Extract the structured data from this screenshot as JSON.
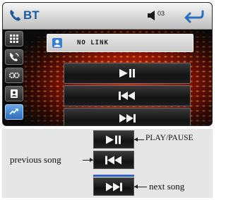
{
  "header": {
    "title": "BT",
    "volume_level": "03",
    "phone_icon": "phone-icon",
    "back_icon": "return-arrow-icon"
  },
  "sidebar": {
    "items": [
      {
        "name": "menu-grid",
        "icon": "grid-icon"
      },
      {
        "name": "dial",
        "icon": "phone-dial-icon"
      },
      {
        "name": "settings",
        "icon": "settings-icon"
      },
      {
        "name": "contacts",
        "icon": "contacts-icon"
      },
      {
        "name": "bt-music",
        "icon": "bluetooth-music-icon",
        "active": true
      }
    ]
  },
  "status": {
    "text": "NO LINK",
    "icon": "user-icon"
  },
  "transport": {
    "play_pause_icon": "play-pause-icon",
    "previous_icon": "previous-track-icon",
    "next_icon": "next-track-icon"
  },
  "legend": {
    "play_pause_label": "PLAY/PAUSE",
    "previous_label": "previous song",
    "next_label": "next song"
  },
  "colors": {
    "accent_blue": "#2f63c9",
    "glow_red": "#e0280a",
    "title_blue": "#1a5a9e"
  }
}
